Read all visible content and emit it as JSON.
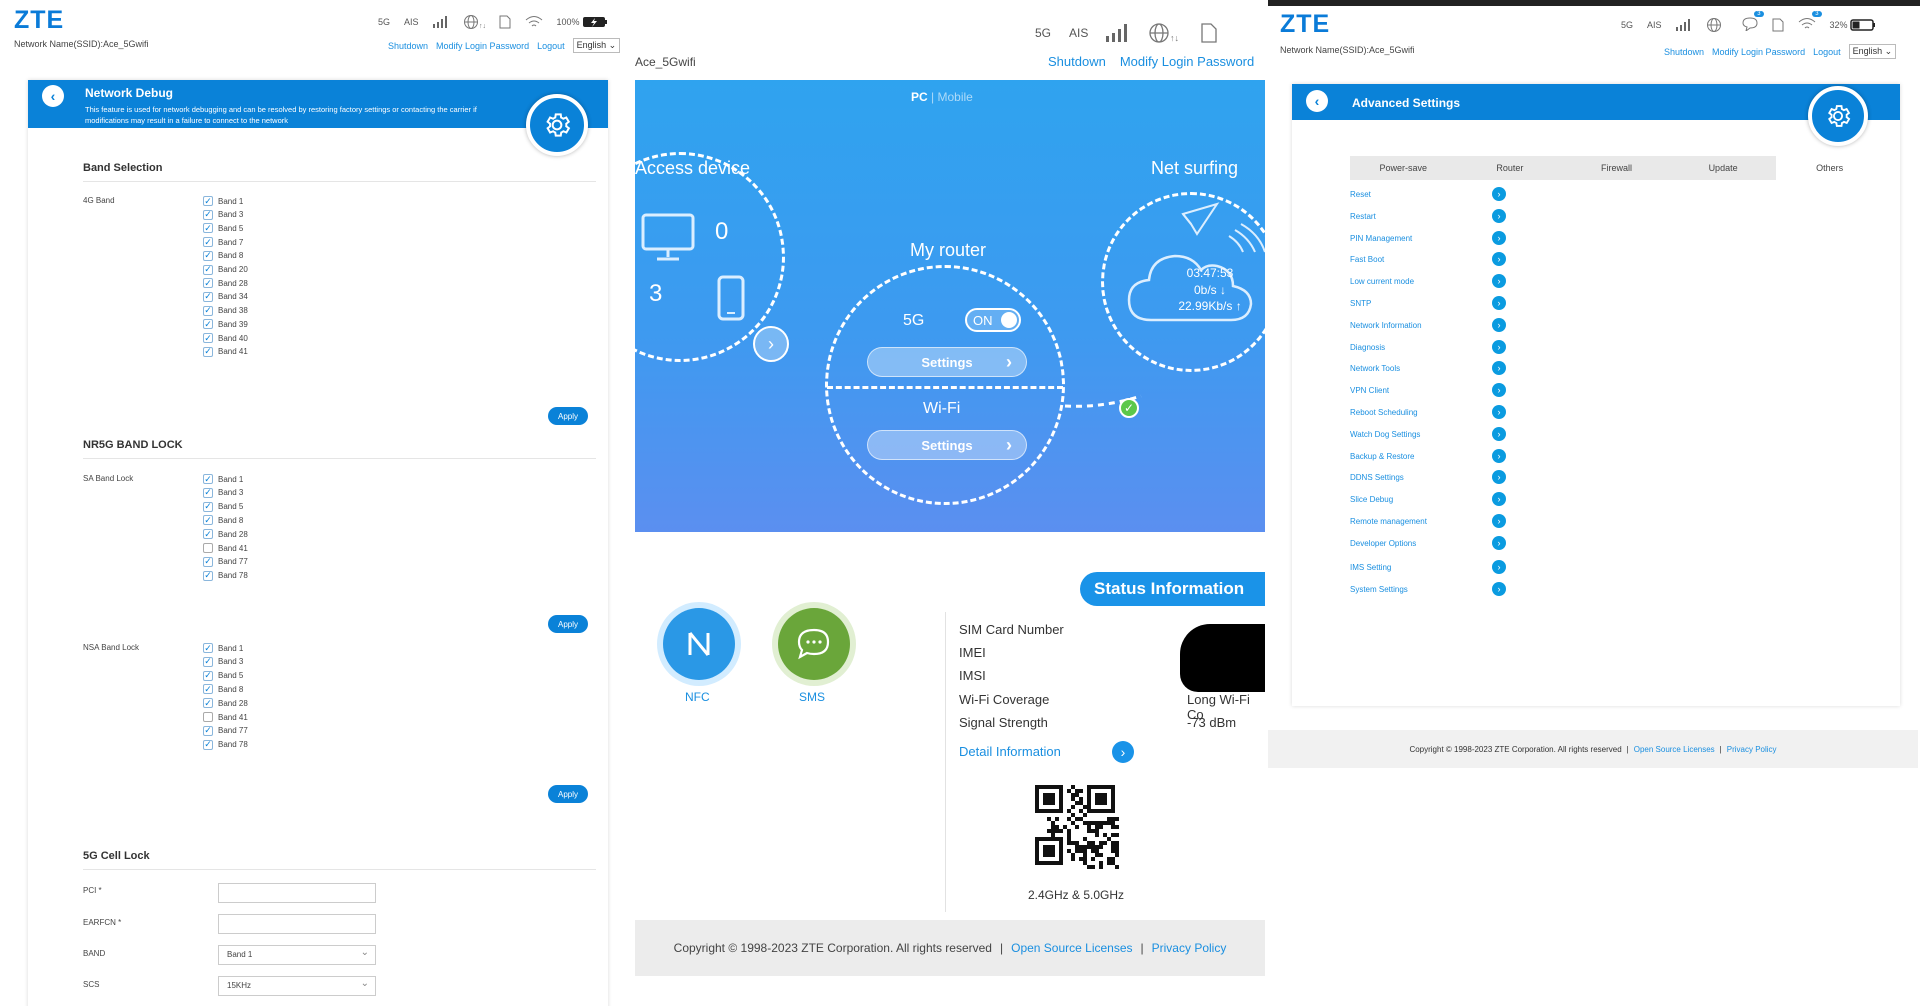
{
  "brand": {
    "logo": "ZTE",
    "ssid_text": "Network Name(SSID):Ace_5Gwifi"
  },
  "status": {
    "net": "5G",
    "carrier": "AIS",
    "battery_left": "100%",
    "battery_right": "32%",
    "sms_count": "3",
    "wifi_count": "3"
  },
  "toplinks": {
    "shutdown": "Shutdown",
    "modify": "Modify Login Password",
    "logout": "Logout",
    "language": "English"
  },
  "debug": {
    "title": "Network Debug",
    "desc": "This feature is used for network debugging and can be resolved by restoring factory settings or contacting the carrier if modifications may result in a failure to connect to the network",
    "band_section": "Band Selection",
    "band4g_label": "4G Band",
    "band4g": [
      {
        "label": "Band 1",
        "checked": true
      },
      {
        "label": "Band 3",
        "checked": true
      },
      {
        "label": "Band 5",
        "checked": true
      },
      {
        "label": "Band 7",
        "checked": true
      },
      {
        "label": "Band 8",
        "checked": true
      },
      {
        "label": "Band 20",
        "checked": true
      },
      {
        "label": "Band 28",
        "checked": true
      },
      {
        "label": "Band 34",
        "checked": true
      },
      {
        "label": "Band 38",
        "checked": true
      },
      {
        "label": "Band 39",
        "checked": true
      },
      {
        "label": "Band 40",
        "checked": true
      },
      {
        "label": "Band 41",
        "checked": true
      }
    ],
    "apply": "Apply",
    "nr_section": "NR5G BAND LOCK",
    "sa_label": "SA Band Lock",
    "sa": [
      {
        "label": "Band 1",
        "checked": true
      },
      {
        "label": "Band 3",
        "checked": true
      },
      {
        "label": "Band 5",
        "checked": true
      },
      {
        "label": "Band 8",
        "checked": true
      },
      {
        "label": "Band 28",
        "checked": true
      },
      {
        "label": "Band 41",
        "checked": false
      },
      {
        "label": "Band 77",
        "checked": true
      },
      {
        "label": "Band 78",
        "checked": true
      }
    ],
    "nsa_label": "NSA Band Lock",
    "nsa": [
      {
        "label": "Band 1",
        "checked": true
      },
      {
        "label": "Band 3",
        "checked": true
      },
      {
        "label": "Band 5",
        "checked": true
      },
      {
        "label": "Band 8",
        "checked": true
      },
      {
        "label": "Band 28",
        "checked": true
      },
      {
        "label": "Band 41",
        "checked": false
      },
      {
        "label": "Band 77",
        "checked": true
      },
      {
        "label": "Band 78",
        "checked": true
      }
    ],
    "cell_section": "5G Cell Lock",
    "pci_label": "PCI *",
    "earfcn_label": "EARFCN *",
    "band_label": "BAND",
    "scs_label": "SCS",
    "band_value": "Band 1",
    "scs_value": "15KHz"
  },
  "home": {
    "ssid_partial": "Ace_5Gwifi",
    "view_pc": "PC",
    "view_sep": "|",
    "view_mobile": "Mobile",
    "access_device": "Access device",
    "count_pc": "0",
    "count_mobile": "3",
    "my_router": "My router",
    "fiveg": "5G",
    "toggle": "ON",
    "settings": "Settings",
    "wifi": "Wi-Fi",
    "net_surfing": "Net surfing",
    "time": "03:47:53",
    "down": "0b/s ↓",
    "up": "22.99Kb/s ↑",
    "nfc": "NFC",
    "sms": "SMS",
    "status_title": "Status Information",
    "rows": [
      "SIM Card Number",
      "IMEI",
      "IMSI",
      "Wi-Fi Coverage",
      "Signal Strength"
    ],
    "coverage_value": "Long Wi-Fi Co",
    "signal_value": "-73 dBm",
    "detail": "Detail Information",
    "qr_caption": "2.4GHz & 5.0GHz"
  },
  "advanced": {
    "title": "Advanced Settings",
    "tabs": [
      {
        "label": "Power-save"
      },
      {
        "label": "Router"
      },
      {
        "label": "Firewall"
      },
      {
        "label": "Update"
      },
      {
        "label": "Others",
        "active": true
      }
    ],
    "items": [
      "Reset",
      "Restart",
      "PIN Management",
      "Fast Boot",
      "Low current mode",
      "SNTP",
      "Network Information",
      "Diagnosis",
      "Network Tools",
      "VPN Client",
      "Reboot Scheduling",
      "Watch Dog Settings",
      "Backup & Restore",
      "DDNS Settings",
      "Slice Debug",
      "Remote management",
      "Developer Options",
      "IMS Setting",
      "System Settings"
    ]
  },
  "footer": {
    "copyright": "Copyright © 1998-2023 ZTE Corporation. All rights reserved",
    "sep": "|",
    "oss": "Open Source Licenses",
    "privacy": "Privacy Policy"
  },
  "colors": {
    "brand_blue": "#0a82d8",
    "link_blue": "#1a8fe0",
    "hero_top": "#2fa3ef",
    "hero_bottom": "#5b8ff0"
  }
}
